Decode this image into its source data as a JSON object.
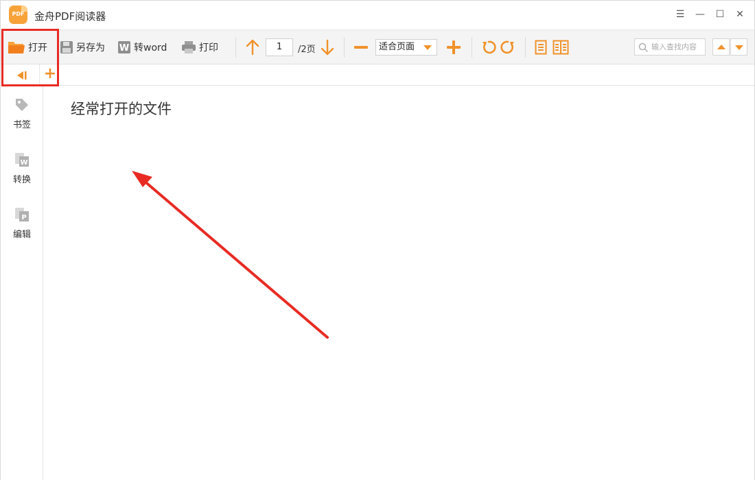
{
  "app": {
    "title": "金舟PDF阅读器",
    "logo_text": "PDF"
  },
  "window_controls": {
    "menu": "☰",
    "minimize": "—",
    "maximize": "☐",
    "close": "✕"
  },
  "toolbar": {
    "open_label": "打开",
    "save_as_label": "另存为",
    "to_word_label": "转word",
    "print_label": "打印",
    "page_current": "1",
    "page_total": "/2页",
    "zoom_mode": "适合页面",
    "search_placeholder": "输入查找内容"
  },
  "sidebar": {
    "items": [
      {
        "label": "书签",
        "icon": "tag-icon"
      },
      {
        "label": "转换",
        "icon": "convert-word-icon"
      },
      {
        "label": "编辑",
        "icon": "edit-pdf-icon"
      }
    ]
  },
  "content": {
    "recent_title": "经常打开的文件"
  },
  "colors": {
    "accent": "#f0922b",
    "highlight": "#e82b23",
    "toolbar_bg": "#f4f4f4"
  }
}
